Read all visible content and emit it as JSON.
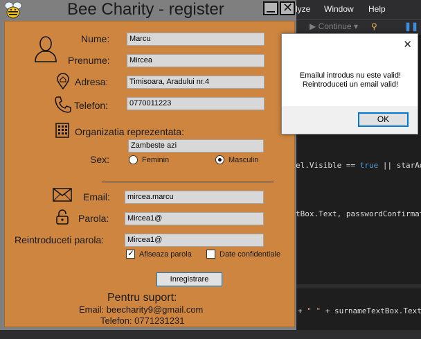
{
  "ide": {
    "menu": [
      "lyze",
      "Window",
      "Help"
    ],
    "toolbar_continue": "Continue",
    "code_lines": [
      {
        "text": "el.Visible == ",
        "kw": "true",
        "rest": " || starAddre"
      },
      {
        "text": "tBox.Text, passwordConfirmatio",
        "kw": "",
        "rest": ""
      },
      {
        "text": "+ ",
        "kw": "\" \"",
        "rest": " + surnameTextBox.Text;"
      }
    ]
  },
  "window": {
    "title": "Bee Charity - register"
  },
  "form": {
    "nume": {
      "label": "Nume:",
      "value": "Marcu"
    },
    "prenume": {
      "label": "Prenume:",
      "value": "Mircea"
    },
    "adresa": {
      "label": "Adresa:",
      "value": "Timisoara, Aradului nr.4"
    },
    "telefon": {
      "label": "Telefon:",
      "value": "0770011223"
    },
    "organizatie": {
      "label": "Organizatia reprezentata:",
      "value": "Zambeste azi"
    },
    "sex": {
      "label": "Sex:",
      "options": [
        "Feminin",
        "Masculin"
      ],
      "selected": "Masculin"
    },
    "email": {
      "label": "Email:",
      "value": "mircea.marcu"
    },
    "parola": {
      "label": "Parola:",
      "value": "Mircea1@"
    },
    "reparola": {
      "label": "Reintroduceti parola:",
      "value": "Mircea1@"
    },
    "show_password": {
      "label": "Afiseaza parola",
      "checked": true
    },
    "confidential": {
      "label": "Date confidentiale",
      "checked": false
    },
    "submit_label": "Inregistrare"
  },
  "support": {
    "title": "Pentru suport:",
    "email": "Email: beecharity9@gmail.com",
    "phone": "Telefon: 0771231231"
  },
  "messagebox": {
    "line1": "Emailul introdus nu este valid!",
    "line2": "Reintroduceti un email valid!",
    "ok_label": "OK",
    "close_glyph": "✕"
  }
}
